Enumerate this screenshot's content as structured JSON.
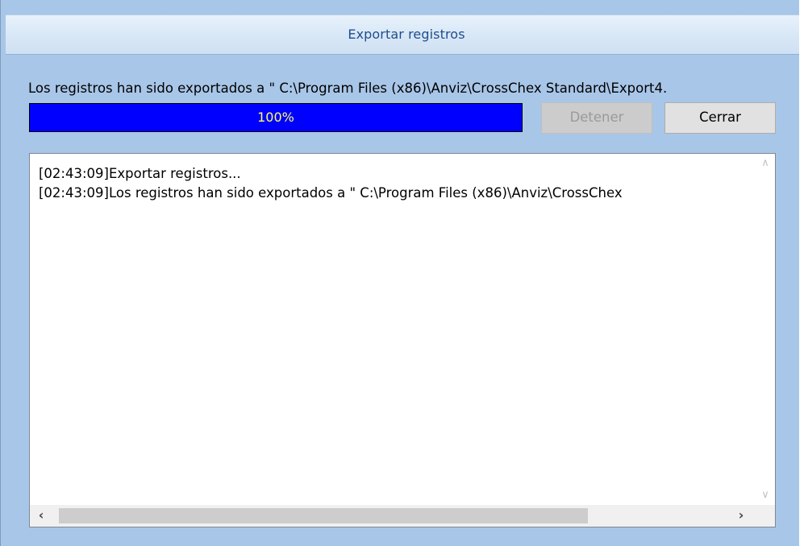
{
  "window": {
    "title": "Exportar registros"
  },
  "message": "Los registros han sido exportados a \" C:\\Program Files (x86)\\Anviz\\CrossChex Standard\\Export4.",
  "progress": {
    "value_percent": 100,
    "label": "100%",
    "fill_color": "#0000ff",
    "label_color": "#ffff66"
  },
  "buttons": {
    "stop_label": "Detener",
    "stop_enabled": false,
    "close_label": "Cerrar"
  },
  "log": {
    "lines": [
      "[02:43:09]Exportar registros...",
      "[02:43:09]Los registros han sido exportados a \" C:\\Program Files (x86)\\Anviz\\CrossChex"
    ]
  },
  "scrollbars": {
    "up_icon": "chevron-up-icon",
    "down_icon": "chevron-down-icon",
    "left_icon": "chevron-left-icon",
    "right_icon": "chevron-right-icon"
  },
  "colors": {
    "window_bg": "#a8c6e8",
    "title_text": "#1f4e8c"
  }
}
